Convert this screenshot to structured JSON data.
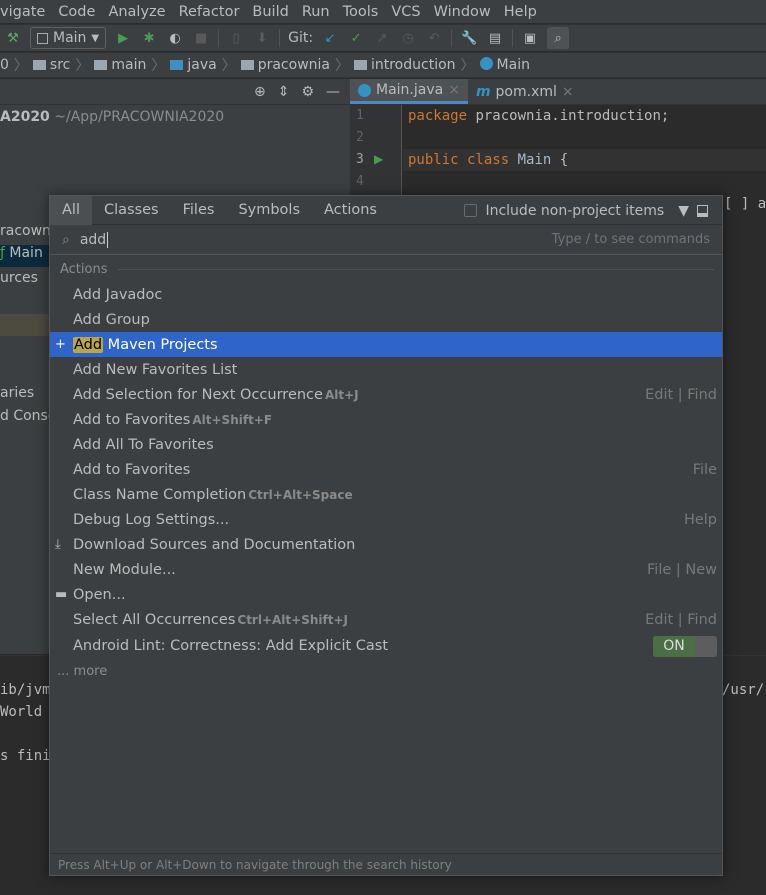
{
  "menu": [
    "vigate",
    "Code",
    "Analyze",
    "Refactor",
    "Build",
    "Run",
    "Tools",
    "VCS",
    "Window",
    "Help"
  ],
  "toolbar": {
    "run_config": "Main",
    "git_label": "Git:"
  },
  "breadcrumb": [
    "0",
    "src",
    "main",
    "java",
    "pracownia",
    "introduction",
    "Main"
  ],
  "project": {
    "root": "A2020",
    "root_path": "~/App/PRACOWNIA2020",
    "items": [
      "racowni",
      "Main",
      "urces",
      "aries",
      "d Conso"
    ]
  },
  "editor": {
    "tabs": [
      {
        "label": "Main.java",
        "active": true
      },
      {
        "label": "pom.xml",
        "active": false
      }
    ],
    "line_numbers": [
      "1",
      "2",
      "3",
      "4"
    ],
    "line1_kw": "package",
    "line1_rest": " pracownia.introduction;",
    "line3_kw": "public class",
    "line3_name": " Main",
    "line3_rest": " {",
    "line5_partial": "[ ] a"
  },
  "console": {
    "lines": [
      "ib/jvm",
      "World",
      "s fini"
    ],
    "right": "/usr/"
  },
  "popup": {
    "tabs": [
      "All",
      "Classes",
      "Files",
      "Symbols",
      "Actions"
    ],
    "include_label": "Include non-project items",
    "search_value": "add",
    "hint": "Type / to see commands",
    "section": "Actions",
    "items": [
      {
        "label": "Add Javadoc"
      },
      {
        "label": "Add Group"
      },
      {
        "hl": "Add",
        "label": " Maven Projects",
        "icon": "plus-icon",
        "selected": true
      },
      {
        "label": "Add New Favorites List"
      },
      {
        "label": "Add Selection for Next Occurrence",
        "shortcut": "Alt+J",
        "group": "Edit | Find"
      },
      {
        "label": "Add to Favorites",
        "shortcut": "Alt+Shift+F"
      },
      {
        "label": "Add All To Favorites"
      },
      {
        "label": "Add to Favorites",
        "group": "File"
      },
      {
        "label": "Class Name Completion",
        "shortcut": "Ctrl+Alt+Space"
      },
      {
        "label": "Debug Log Settings...",
        "group": "Help"
      },
      {
        "label": "Download Sources and Documentation",
        "icon": "download-icon"
      },
      {
        "label": "New Module...",
        "group": "File | New"
      },
      {
        "label": "Open...",
        "icon": "folder-open-icon"
      },
      {
        "label": "Select All Occurrences",
        "shortcut": "Ctrl+Alt+Shift+J",
        "group": "Edit | Find"
      }
    ],
    "lint_item": "Android Lint: Correctness: Add Explicit Cast",
    "toggle_label": "ON",
    "toggle_on": true,
    "more": "... more",
    "footer": "Press Alt+Up or Alt+Down to navigate through the search history"
  }
}
